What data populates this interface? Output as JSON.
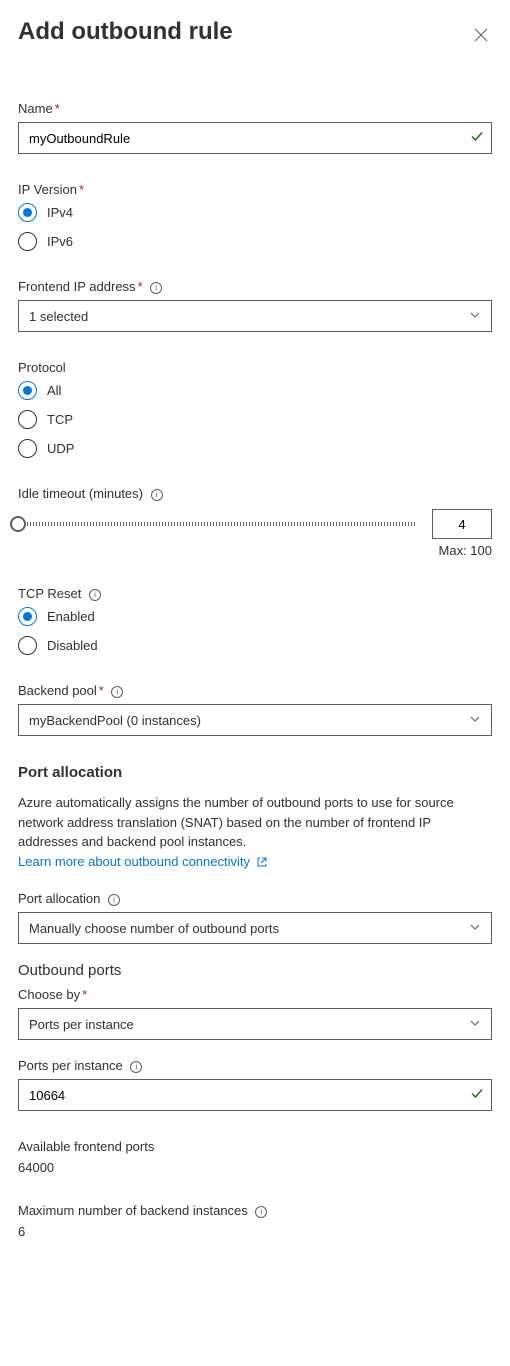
{
  "header": {
    "title": "Add outbound rule"
  },
  "name": {
    "label": "Name",
    "value": "myOutboundRule"
  },
  "ip_version": {
    "label": "IP Version",
    "options": [
      "IPv4",
      "IPv6"
    ],
    "selected": "IPv4"
  },
  "frontend_ip": {
    "label": "Frontend IP address",
    "value": "1 selected"
  },
  "protocol": {
    "label": "Protocol",
    "options": [
      "All",
      "TCP",
      "UDP"
    ],
    "selected": "All"
  },
  "idle_timeout": {
    "label": "Idle timeout (minutes)",
    "value": "4",
    "max_label": "Max: 100"
  },
  "tcp_reset": {
    "label": "TCP Reset",
    "options": [
      "Enabled",
      "Disabled"
    ],
    "selected": "Enabled"
  },
  "backend_pool": {
    "label": "Backend pool",
    "value": "myBackendPool (0 instances)"
  },
  "port_allocation": {
    "title": "Port allocation",
    "description": "Azure automatically assigns the number of outbound ports to use for source network address translation (SNAT) based on the number of frontend IP addresses and backend pool instances.",
    "link_text": "Learn more about outbound connectivity",
    "label": "Port allocation",
    "value": "Manually choose number of outbound ports"
  },
  "outbound_ports": {
    "title": "Outbound ports",
    "choose_by_label": "Choose by",
    "choose_by_value": "Ports per instance",
    "ports_label": "Ports per instance",
    "ports_value": "10664"
  },
  "available_ports": {
    "label": "Available frontend ports",
    "value": "64000"
  },
  "max_backend": {
    "label": "Maximum number of backend instances",
    "value": "6"
  }
}
